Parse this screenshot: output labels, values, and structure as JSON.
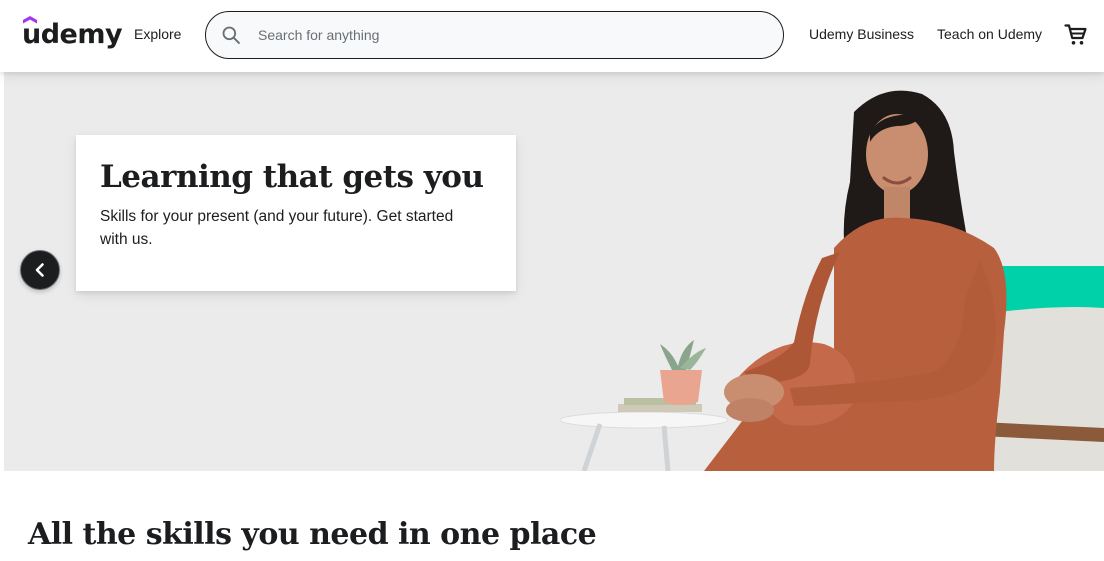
{
  "header": {
    "logo_text": "udemy",
    "explore_label": "Explore",
    "search_placeholder": "Search for anything",
    "search_value": "",
    "business_label": "Udemy Business",
    "teach_label": "Teach on Udemy",
    "icons": {
      "search": "search-icon",
      "cart": "cart-icon"
    }
  },
  "hero": {
    "title": "Learning that gets you",
    "subtitle": "Skills for your present (and your future). Get started with us.",
    "prev_icon": "chevron-left-icon"
  },
  "section": {
    "title": "All the skills you need in one place"
  },
  "colors": {
    "brand_purple": "#a435f0",
    "text_dark": "#1c1d1f",
    "hero_bg": "#ebebeb",
    "accent_teal": "#00d1a8"
  }
}
